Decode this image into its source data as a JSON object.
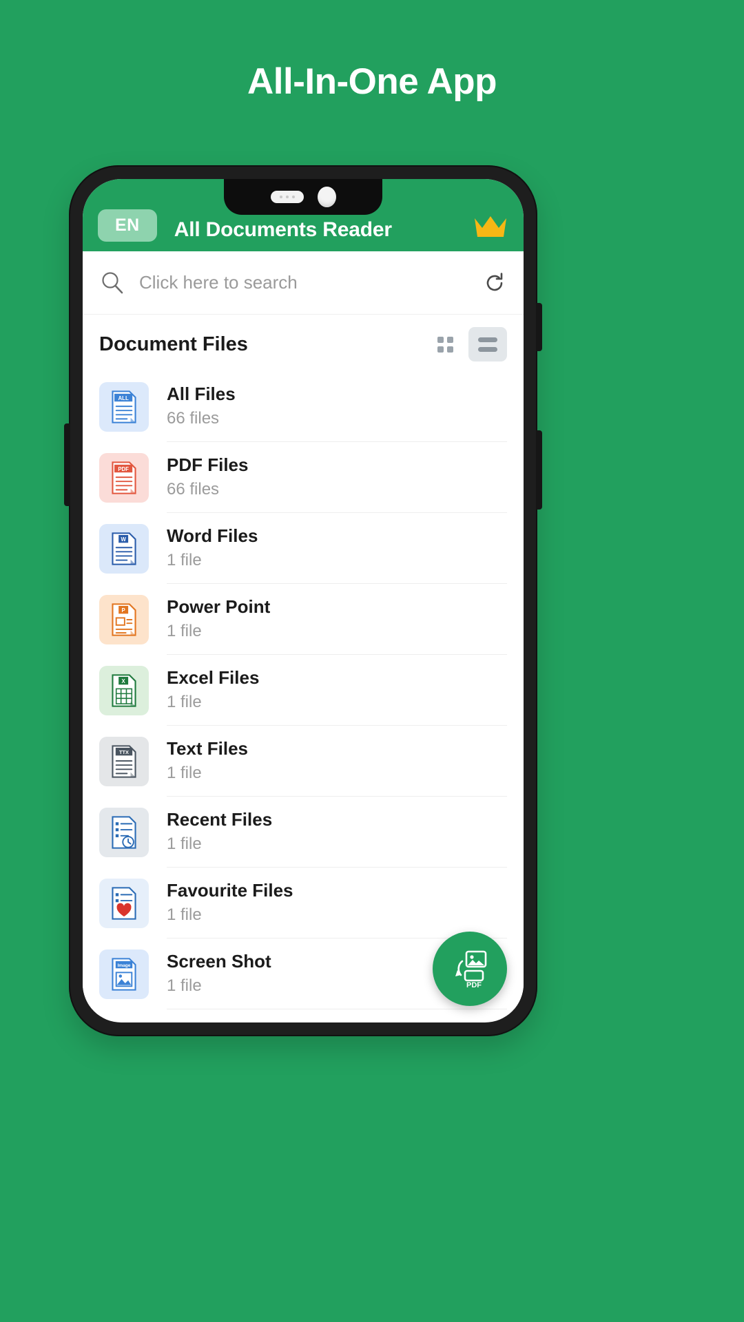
{
  "promo": {
    "headline": "All-In-One App",
    "background_color": "#22a05e"
  },
  "app": {
    "brand_color": "#22a05e",
    "lang_badge": "EN",
    "title": "All Documents Reader",
    "premium_icon": "crown-icon"
  },
  "search": {
    "placeholder": "Click here to search",
    "search_icon": "search-icon",
    "refresh_icon": "refresh-icon"
  },
  "section": {
    "title": "Document Files",
    "grid_view_icon": "grid-view-icon",
    "list_view_icon": "list-view-icon",
    "active_view": "list"
  },
  "files": [
    {
      "name": "All Files",
      "count": "66 files",
      "icon": "all-files-icon",
      "badge": "ALL",
      "bg": "#dce9fb",
      "accent": "#3b82d6"
    },
    {
      "name": "PDF Files",
      "count": "66 files",
      "icon": "pdf-files-icon",
      "badge": "PDF",
      "bg": "#fbdcd8",
      "accent": "#e2573f"
    },
    {
      "name": "Word Files",
      "count": "1 file",
      "icon": "word-files-icon",
      "badge": "W",
      "bg": "#dbe8fa",
      "accent": "#2a5caa"
    },
    {
      "name": "Power Point",
      "count": "1 file",
      "icon": "powerpoint-files-icon",
      "badge": "P",
      "bg": "#fde3cb",
      "accent": "#e2751f"
    },
    {
      "name": "Excel Files",
      "count": "1 file",
      "icon": "excel-files-icon",
      "badge": "X",
      "bg": "#dcefdc",
      "accent": "#1f7a3d"
    },
    {
      "name": "Text Files",
      "count": "1 file",
      "icon": "text-files-icon",
      "badge": "TTX",
      "bg": "#e4e6e8",
      "accent": "#4a5560"
    },
    {
      "name": "Recent Files",
      "count": "1 file",
      "icon": "recent-files-icon",
      "badge": "",
      "bg": "#e4e8ec",
      "accent": "#2a6bb5"
    },
    {
      "name": "Favourite Files",
      "count": "1 file",
      "icon": "favourite-files-icon",
      "badge": "",
      "bg": "#e6effa",
      "accent": "#2a6bb5"
    },
    {
      "name": "Screen Shot",
      "count": "1 file",
      "icon": "screenshot-files-icon",
      "badge": "Image",
      "bg": "#dce9fb",
      "accent": "#3b82d6"
    }
  ],
  "fab": {
    "icon": "image-to-pdf-icon",
    "label": "PDF",
    "color": "#22a05e"
  }
}
